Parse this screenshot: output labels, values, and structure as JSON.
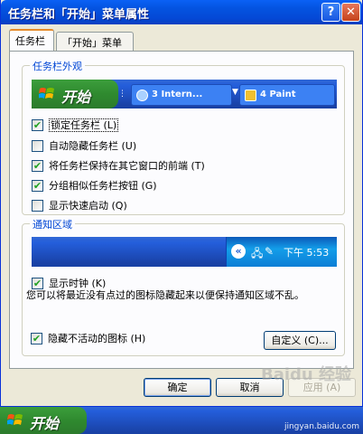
{
  "window": {
    "title": "任务栏和「开始」菜单属性",
    "help_label": "?",
    "close_label": "✕"
  },
  "tabs": [
    {
      "label": "任务栏",
      "active": true
    },
    {
      "label": "「开始」菜单",
      "active": false
    }
  ],
  "appearance": {
    "title": "任务栏外观",
    "preview": {
      "start_label": "开始",
      "task_buttons": [
        {
          "label": "3 Intern...",
          "icon": "ie-icon"
        },
        {
          "label": "4 Paint",
          "icon": "paint-icon"
        }
      ]
    },
    "options": [
      {
        "label": "锁定任务栏 (L)",
        "checked": true,
        "focused": true
      },
      {
        "label": "自动隐藏任务栏 (U)",
        "checked": false,
        "focused": false
      },
      {
        "label": "将任务栏保持在其它窗口的前端 (T)",
        "checked": true,
        "focused": false
      },
      {
        "label": "分组相似任务栏按钮 (G)",
        "checked": true,
        "focused": false
      },
      {
        "label": "显示快速启动 (Q)",
        "checked": false,
        "focused": false
      }
    ]
  },
  "notification": {
    "title": "通知区域",
    "preview": {
      "expand_label": "«",
      "clock": "下午 5:53"
    },
    "show_clock": {
      "label": "显示时钟 (K)",
      "checked": true
    },
    "description": "您可以将最近没有点过的图标隐藏起来以便保持通知区域不乱。",
    "hide_inactive": {
      "label": "隐藏不活动的图标 (H)",
      "checked": true
    },
    "customize_label": "自定义 (C)..."
  },
  "buttons": {
    "ok": "确定",
    "cancel": "取消",
    "apply": "应用 (A)"
  },
  "taskbar": {
    "start_label": "开始",
    "watermark": "jingyan.baidu.com",
    "watermark_logo": "Baidu 经验"
  },
  "colors": {
    "title_bar": "#0453e0",
    "start_green": "#2f8a2f",
    "taskbar_blue": "#245edb",
    "group_label": "#0046d5"
  }
}
